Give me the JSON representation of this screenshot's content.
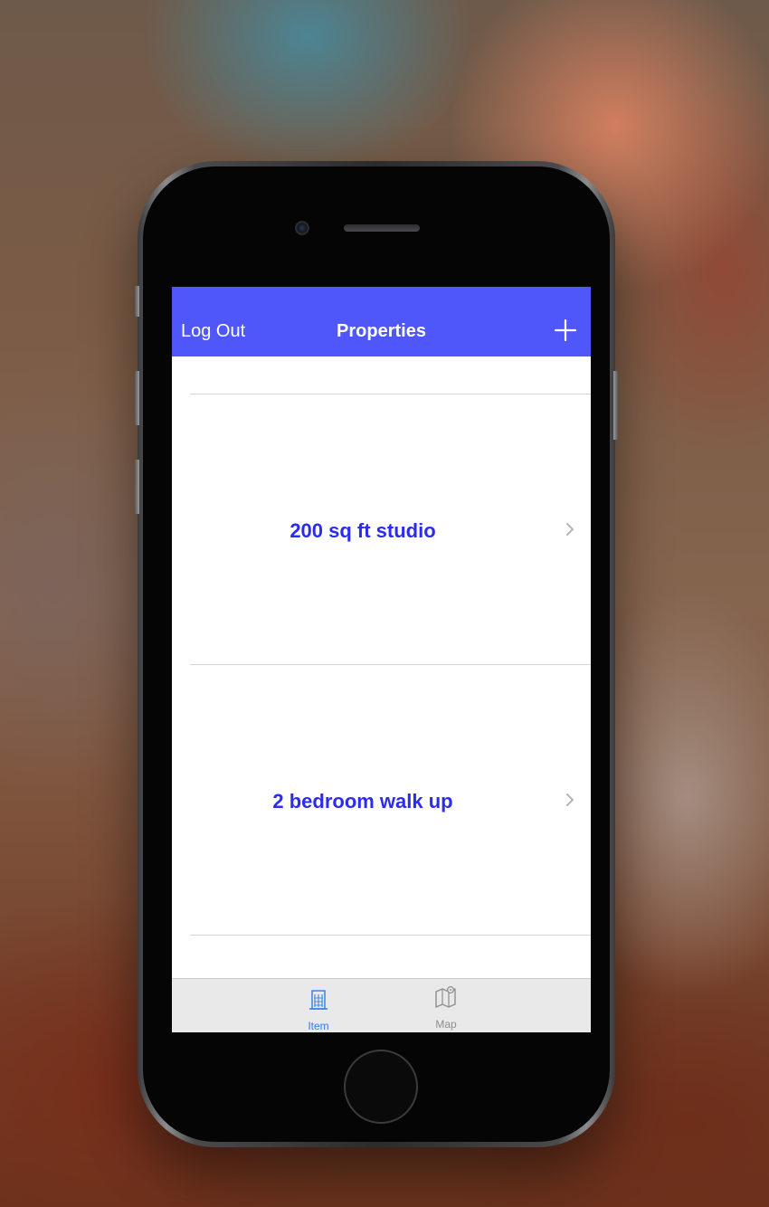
{
  "navbar": {
    "left_label": "Log Out",
    "title": "Properties",
    "add_icon": "plus-icon"
  },
  "list": {
    "items": [
      {
        "label": "200 sq ft studio",
        "accessory": "chevron-right-icon"
      },
      {
        "label": "2 bedroom walk up",
        "accessory": "chevron-right-icon"
      }
    ]
  },
  "tabbar": {
    "tabs": [
      {
        "label": "Item",
        "icon": "building-icon",
        "selected": true
      },
      {
        "label": "Map",
        "icon": "map-icon",
        "selected": false
      }
    ]
  },
  "colors": {
    "navbar_bg": "#4f57fb",
    "row_text": "#2b2cf0",
    "tab_active": "#2f7de1",
    "tab_inactive": "#8e8e93"
  }
}
